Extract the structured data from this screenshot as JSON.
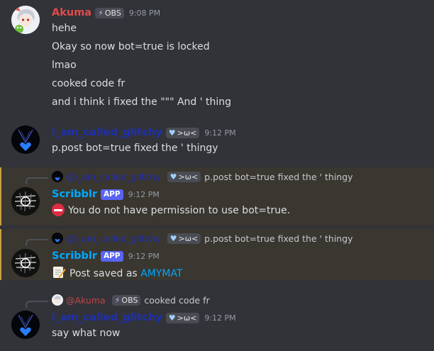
{
  "akuma_msg": {
    "author": "Akuma",
    "tag": "OBS",
    "time": "9:08 PM",
    "lines": [
      "hehe",
      "Okay so now bot=true is locked",
      "lmao",
      "cooked code fr",
      "and i think i fixed the \"\"\" And ' thing"
    ]
  },
  "glitchy_msg1": {
    "author": "i_am_called_glitchy",
    "tag": ">ω<",
    "time": "9:12 PM",
    "text": "p.post bot=true fixed the ' thingy"
  },
  "scribblr_msg1": {
    "reply": {
      "author": "@i_am_called_glitchy",
      "tag": ">ω<",
      "content": "p.post bot=true fixed the ' thingy"
    },
    "author": "Scribblr",
    "badge": "APP",
    "time": "9:12 PM",
    "text": "You do not have permission to use bot=true."
  },
  "scribblr_msg2": {
    "reply": {
      "author": "@i_am_called_glitchy",
      "tag": ">ω<",
      "content": "p.post bot=true fixed the ' thingy"
    },
    "author": "Scribblr",
    "badge": "APP",
    "time": "9:12 PM",
    "text_prefix": "Post saved as",
    "link": "AMYMAT"
  },
  "glitchy_msg2": {
    "reply": {
      "author": "@Akuma",
      "tag": "OBS",
      "content": "cooked code fr"
    },
    "author": "i_am_called_glitchy",
    "tag": ">ω<",
    "time": "9:12 PM",
    "text": "say what now"
  },
  "icons": [
    "avatar-akuma",
    "avatar-glitchy",
    "avatar-scribblr",
    "bolt-icon",
    "heart-icon",
    "no-entry-icon",
    "memo-icon"
  ],
  "colors": {
    "background": "#313338",
    "mention_highlight": "#3a3630",
    "mention_bar": "#c9a040",
    "akuma": "#e34a4a",
    "glitchy": "#1e2fb5",
    "scribblr": "#00aaff",
    "app_badge": "#5865f2",
    "link": "#00a8fc"
  }
}
